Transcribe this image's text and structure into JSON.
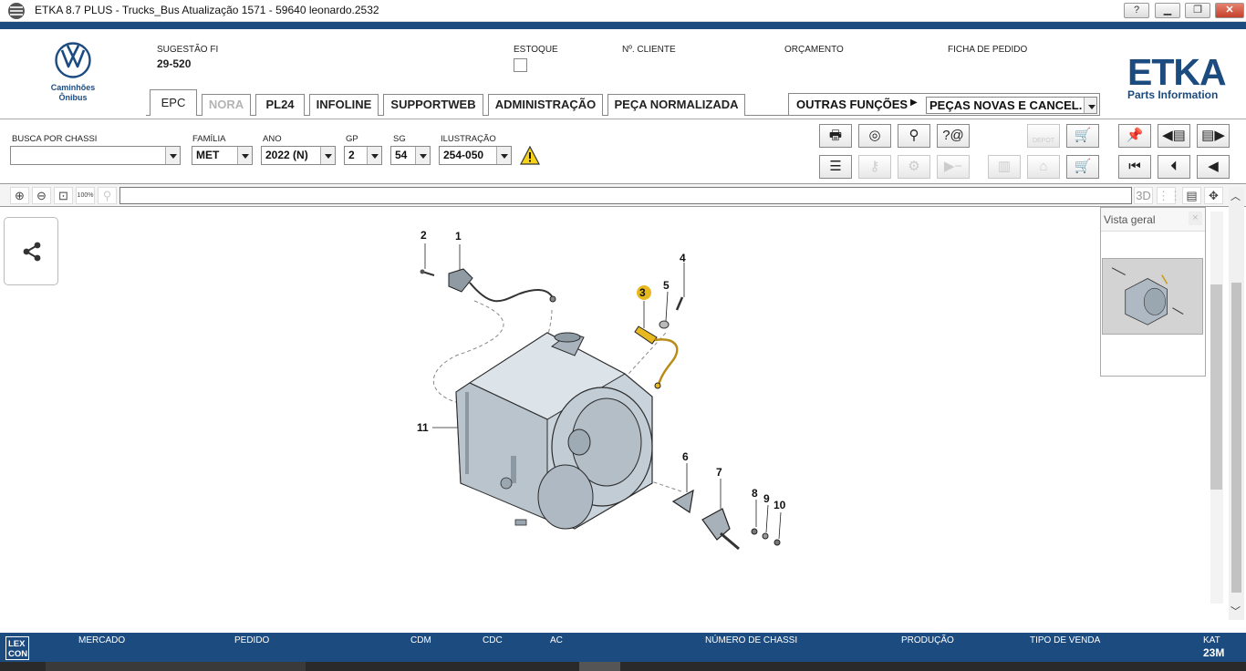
{
  "window": {
    "title": "ETKA 8.7 PLUS - Trucks_Bus Atualização 1571 - 59640 leonardo.2532",
    "help_label": "?",
    "minimize_label": "▁",
    "maximize_label": "❐",
    "close_label": "✕"
  },
  "brand": {
    "caption_line1": "Caminhões",
    "caption_line2": "Ônibus",
    "etka_text": "ETKA",
    "etka_sub": "Parts Information",
    "accent": "#1c4b80"
  },
  "header": {
    "sugestao_label": "SUGESTÃO FI",
    "sugestao_value": "29-520",
    "estoque_label": "ESTOQUE",
    "cliente_label": "Nº. CLIENTE",
    "orcamento_label": "ORÇAMENTO",
    "ficha_label": "FICHA DE PEDIDO"
  },
  "tabs": [
    {
      "label": "EPC"
    },
    {
      "label": "NORA"
    },
    {
      "label": "PL24"
    },
    {
      "label": "INFOLINE"
    },
    {
      "label": "SUPPORTWEB"
    },
    {
      "label": "ADMINISTRAÇÃO"
    },
    {
      "label": "PEÇA NORMALIZADA"
    }
  ],
  "outras": {
    "label": "OUTRAS FUNÇÕES",
    "select_value": "PEÇAS NOVAS E CANCEL."
  },
  "filters": {
    "chassi_label": "BUSCA POR CHASSI",
    "chassi_value": "",
    "familia_label": "FAMÍLIA",
    "familia_value": "MET",
    "ano_label": "ANO",
    "ano_value": "2022 (N)",
    "gp_label": "GP",
    "gp_value": "2",
    "sg_label": "SG",
    "sg_value": "54",
    "ilustracao_label": "ILUSTRAÇÃO",
    "ilustracao_value": "254-050"
  },
  "toolbar": {
    "depot_label": "DEPOT",
    "zoom_100_label": "100%",
    "btn_3d_label": "3D"
  },
  "diagram": {
    "part_labels": [
      "1",
      "2",
      "3",
      "4",
      "5",
      "6",
      "7",
      "8",
      "9",
      "10",
      "11"
    ],
    "highlight_color": "#e8b820"
  },
  "overview": {
    "title": "Vista geral",
    "close_label": "×"
  },
  "statusbar": {
    "logo_line1": "LEX",
    "logo_line2": "CON",
    "mercado_label": "MERCADO",
    "pedido_label": "PEDIDO",
    "cdm_label": "CDM",
    "cdc_label": "CDC",
    "ac_label": "AC",
    "chassi_label": "NÚMERO DE CHASSI",
    "producao_label": "PRODUÇÃO",
    "tipo_venda_label": "TIPO DE VENDA",
    "kat_label": "KAT",
    "kat_value": "23M"
  }
}
